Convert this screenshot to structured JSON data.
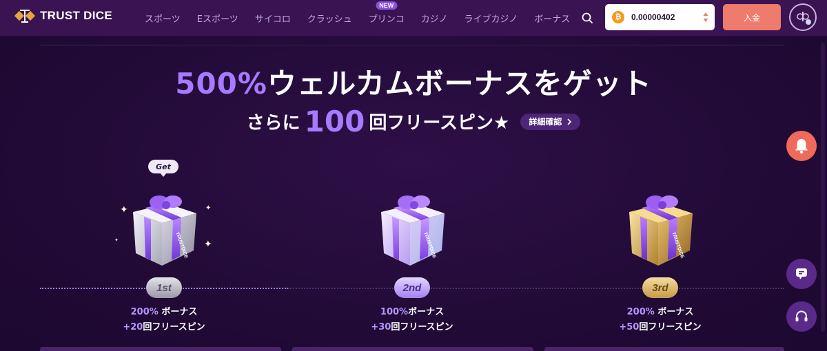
{
  "brand": {
    "name": "TRUST DICE"
  },
  "nav": {
    "items": [
      {
        "label": "スポーツ"
      },
      {
        "label": "Eスポーツ"
      },
      {
        "label": "サイコロ"
      },
      {
        "label": "クラッシュ"
      },
      {
        "label": "プリンコ",
        "badge": "NEW"
      },
      {
        "label": "カジノ"
      },
      {
        "label": "ライブカジノ"
      },
      {
        "label": "ボーナス"
      }
    ]
  },
  "wallet": {
    "currency_icon": "bitcoin-icon",
    "amount": "0.00000402"
  },
  "header": {
    "deposit_label": "入金"
  },
  "hero": {
    "headline_pct": "500%",
    "headline_rest": "ウェルカムボーナスをゲット",
    "sub_pre": "さらに",
    "sub_num": "100",
    "sub_post": "回フリースピン★",
    "details_label": "詳細確認"
  },
  "tiers": [
    {
      "rank": "1st",
      "bubble": "Get",
      "bonus_pct": "200%",
      "bonus_text": " ボーナス",
      "spins_num": "+20",
      "spins_text": "回フリースピン"
    },
    {
      "rank": "2nd",
      "bonus_pct": "100%",
      "bonus_text": "ボーナス",
      "spins_num": "+30",
      "spins_text": "回フリースピン"
    },
    {
      "rank": "3rd",
      "bonus_pct": "200%",
      "bonus_text": " ボーナス",
      "spins_num": "+50",
      "spins_text": "回フリースピン"
    }
  ],
  "gift_label": "TRUSTDICE",
  "colors": {
    "accent": "#a77aff",
    "header_bg": "#3a1452",
    "page_bg": "#230b38",
    "deposit": "#ee7b6b"
  }
}
